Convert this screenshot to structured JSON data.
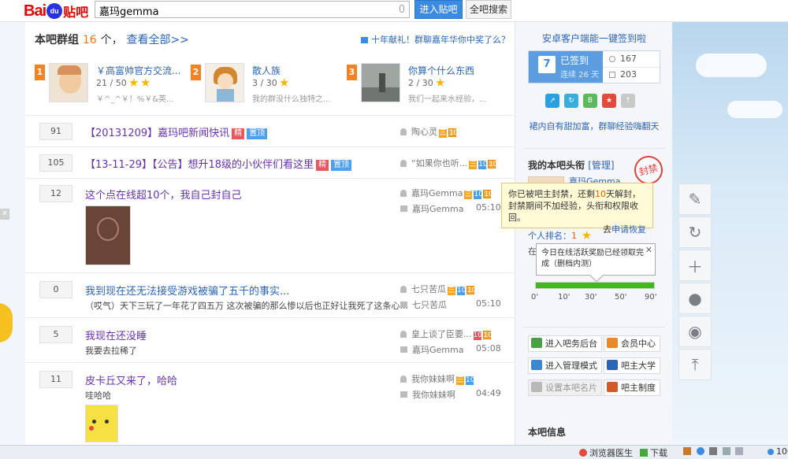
{
  "header": {
    "logo_brand": "Bai",
    "logo_paw": "du",
    "logo_product": "贴吧",
    "search_value": "嘉玛gemma",
    "enter_button": "进入贴吧",
    "all_search_button": "全吧搜索"
  },
  "groups": {
    "title": "本吧群组",
    "count": "16",
    "count_suffix": "个，",
    "view_all": "查看全部>>",
    "notice": "十年献礼！群聊嘉年华你中奖了么？",
    "items": [
      {
        "rank": "1",
        "name": "￥高富帅官方交流...",
        "count": "21 / 50",
        "stars": 2,
        "desc": "￥^_^￥！%￥&英..."
      },
      {
        "rank": "2",
        "name": "散人族",
        "count": "3 / 30",
        "stars": 1,
        "desc": "我的群没什么独特之..."
      },
      {
        "rank": "3",
        "name": "你算个什么东西",
        "count": "2 / 30",
        "stars": 1,
        "desc": "我们一起来水经验，..."
      }
    ]
  },
  "threads": [
    {
      "replies": "91",
      "title": "【20131209】嘉玛吧新闻快讯",
      "tags": [
        "精",
        "置顶"
      ],
      "author": "陶心灵",
      "badges": [
        "三",
        "10"
      ]
    },
    {
      "replies": "105",
      "title": "【13-11-29】【公告】想升18级的小伙伴们看这里",
      "tags": [
        "精",
        "置顶"
      ],
      "author": "“如果你也听...",
      "badges": [
        "三",
        "10",
        "10"
      ]
    },
    {
      "replies": "12",
      "title": "这个点在线超10个，我自己封自己",
      "author": "嘉玛Gemma",
      "badges": [
        "三",
        "10",
        "10"
      ],
      "last_reply": "嘉玛Gemma",
      "time": "05:10"
    },
    {
      "replies": "0",
      "title": "我到现在还无法接受游戏被骗了五千的事实...",
      "abstract": "（哎气）天下三玩了一年花了四五万 这次被骗的那么惨以后也正好让我死了这条心...",
      "author": "七只苦瓜",
      "badges": [
        "三",
        "10",
        "10"
      ],
      "last_reply": "七只苦瓜",
      "time": "05:10"
    },
    {
      "replies": "5",
      "title": "我现在还没睡",
      "abstract": "我要去拉稀了",
      "author": "皇上谈了臣要...",
      "badges": [
        "10",
        "10"
      ],
      "last_reply": "嘉玛Gemma",
      "time": "05:08"
    },
    {
      "replies": "11",
      "title": "皮卡丘又来了，哈哈",
      "abstract": "哇哈哈",
      "author": "我你妹妹啊",
      "badges": [
        "三",
        "10"
      ],
      "last_reply": "我你妹妹啊",
      "time": "04:49"
    }
  ],
  "aside": {
    "android_link": "安卓客户端能一键签到啦",
    "signed_label": "已签到",
    "streak": "连续 26 天",
    "calendar_day": "7",
    "stat1": "167",
    "stat2": "203",
    "group_link": "裙内自有甜加富，群聊经验嗨翻天",
    "my_title": "我的本吧头衔",
    "manage_label": "[管理]",
    "seal_text": "封禁",
    "my_name": "嘉玛Gemma",
    "rank_label": "个人排名：",
    "rank_value": "1",
    "in_mark": "在",
    "tooltip_ban": {
      "line1a": "你已被吧主封禁，还剩",
      "days": "10",
      "line1b": "天解封，",
      "line2": "封禁期间不加经验，头衔和权限收回。",
      "line3a": "去",
      "line3b": "申请恢复"
    },
    "tooltip_online": {
      "text": "今日在线活跃奖励已经领取完成（删档内测）",
      "close": "✕"
    },
    "progress": {
      "fraction": 1.0,
      "ticks": [
        "0'",
        "10'",
        "30'",
        "50'",
        "90'"
      ]
    },
    "buttons": [
      {
        "label": "进入吧务后台",
        "color": "#4a9e46"
      },
      {
        "label": "会员中心",
        "color": "#e88a2a"
      },
      {
        "label": "进入管理模式",
        "color": "#3d86d1"
      },
      {
        "label": "吧主大学",
        "color": "#2d64b3"
      },
      {
        "label": "设置本吧名片",
        "color": "#b8b8b8"
      },
      {
        "label": "吧主制度",
        "color": "#d05a2a"
      }
    ],
    "info_title": "本吧信息"
  },
  "float_toolbar": [
    "edit-icon",
    "refresh-icon",
    "plus-icon",
    "user-icon",
    "user2-icon",
    "top-icon"
  ],
  "statusbar": {
    "doctor": "浏览器医生",
    "download": "下载",
    "zoom": "100"
  },
  "colors": {
    "accent": "#3b8be0",
    "link": "#2d64b3",
    "orange": "#f07818"
  }
}
